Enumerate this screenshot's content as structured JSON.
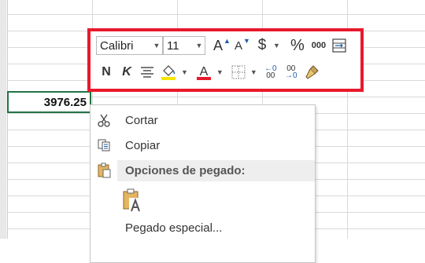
{
  "cell": {
    "value": "3976.25"
  },
  "toolbar": {
    "font_name": "Calibri",
    "font_size": "11",
    "grow_glyph": "A",
    "shrink_glyph": "A",
    "currency_glyph": "$",
    "percent_glyph": "%",
    "thousands_glyph": "000",
    "bold_glyph": "N",
    "italic_glyph": "K",
    "font_color_glyph": "A",
    "inc_decimal_top": "←0",
    "inc_decimal_bottom": "00",
    "dec_decimal_top": "00",
    "dec_decimal_bottom": "→0",
    "fill_color": "#f5e500",
    "font_color": "#e8192b",
    "highlight_border": "#e8192b"
  },
  "context_menu": {
    "cut_label": "Cortar",
    "copy_label": "Copiar",
    "paste_options_header": "Opciones de pegado:",
    "paste_special_label": "Pegado especial..."
  }
}
